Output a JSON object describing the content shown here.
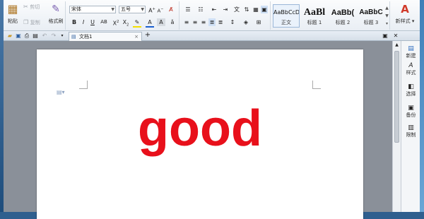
{
  "ribbon": {
    "clipboard": {
      "paste": "粘贴",
      "cut": "剪切",
      "copy": "复制",
      "format_painter": "格式刷"
    },
    "font": {
      "name": "宋体",
      "size": "五号"
    },
    "styles": [
      {
        "preview": "AaBbCcDd",
        "name": "正文"
      },
      {
        "preview": "AaBl",
        "name": "标题 1"
      },
      {
        "preview": "AaBb(",
        "name": "标题 2"
      },
      {
        "preview": "AaBbC",
        "name": "标题 3"
      }
    ],
    "new_style": "新样式"
  },
  "tabbar": {
    "doc_title": "文档1",
    "close": "×",
    "add": "+"
  },
  "document": {
    "text": "good",
    "text_color": "#e8101b"
  },
  "right_panel": [
    {
      "icon": "new-icon",
      "glyph": "▤",
      "label": "新建"
    },
    {
      "icon": "style-icon",
      "glyph": "A",
      "label": "样式"
    },
    {
      "icon": "select-icon",
      "glyph": "◧",
      "label": "选择"
    },
    {
      "icon": "backup-icon",
      "glyph": "▣",
      "label": "备份"
    },
    {
      "icon": "limit-icon",
      "glyph": "▥",
      "label": "限制"
    }
  ]
}
